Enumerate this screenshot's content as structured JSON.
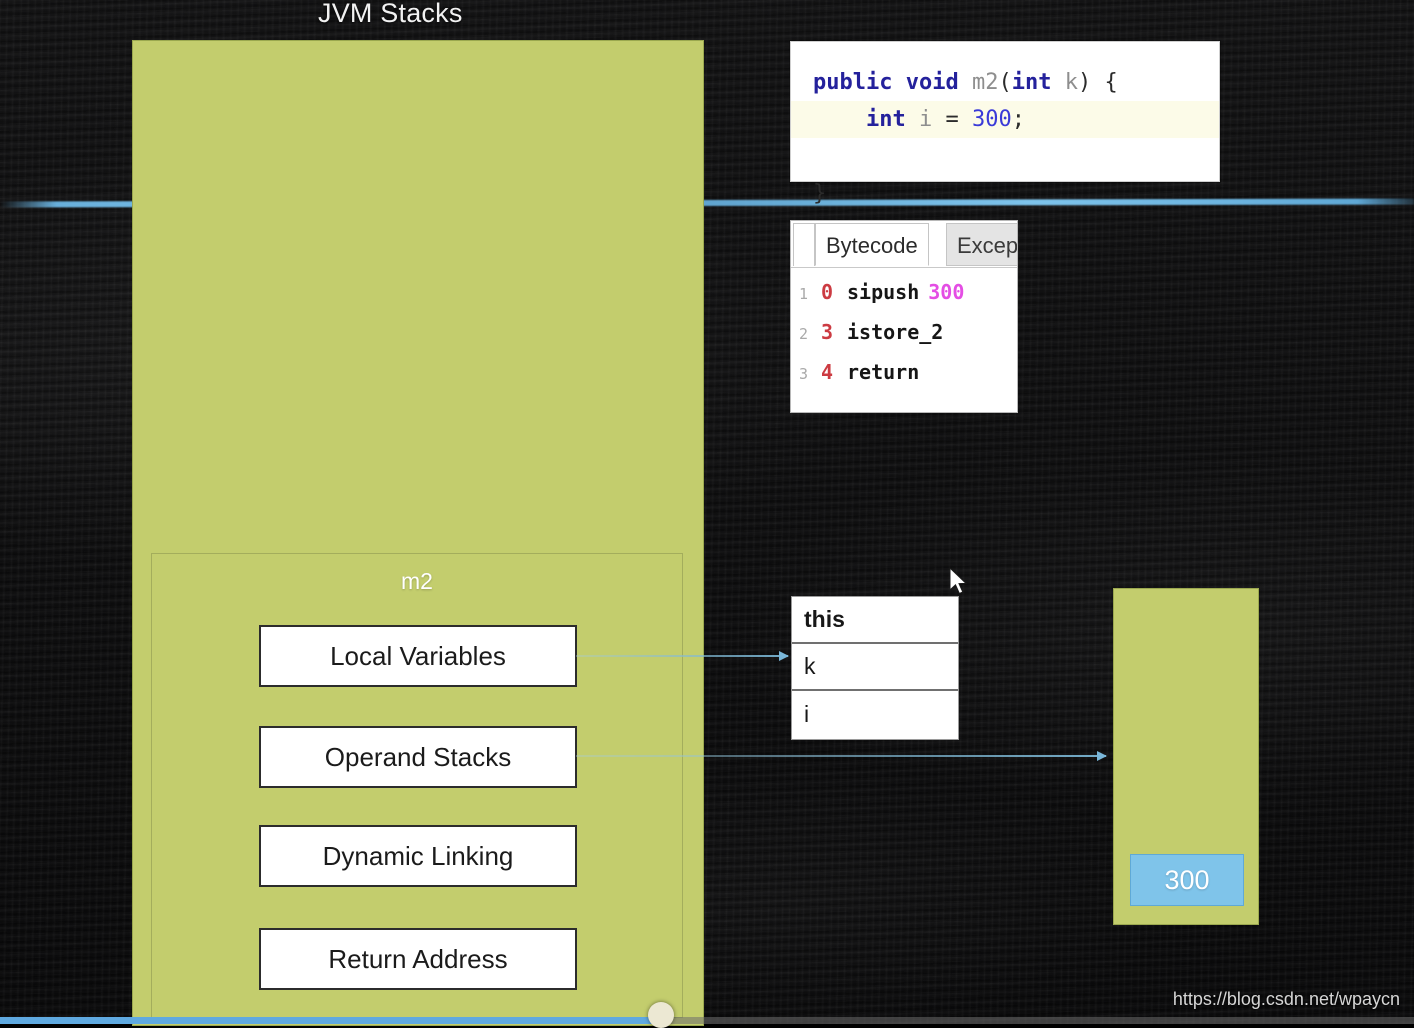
{
  "title": "JVM Stacks",
  "source_card": {
    "line1": {
      "kw1": "public",
      "kw2": "void",
      "method": "m2",
      "open_paren": "(",
      "type": "int",
      "param": "k",
      "close": ") {"
    },
    "line2": {
      "indent": "    ",
      "type": "int",
      "var": "i",
      "eq": " = ",
      "value": "300",
      "semi": ";"
    },
    "line3": "}"
  },
  "bytecode_card": {
    "tabs": [
      {
        "label": "",
        "name": "tab-stub",
        "active": false
      },
      {
        "label": "Bytecode",
        "name": "tab-bytecode",
        "active": true
      },
      {
        "label": "Excep",
        "name": "tab-exceptions",
        "active": false
      }
    ],
    "rows": [
      {
        "lineno": "1",
        "offset": "0",
        "instr": "sipush",
        "operand": "300"
      },
      {
        "lineno": "2",
        "offset": "3",
        "instr": "istore_2",
        "operand": ""
      },
      {
        "lineno": "3",
        "offset": "4",
        "instr": "return",
        "operand": ""
      }
    ]
  },
  "stack_frame": {
    "label": "m2",
    "slots": [
      {
        "label": "Local Variables",
        "name": "slot-local-variables"
      },
      {
        "label": "Operand Stacks",
        "name": "slot-operand-stacks"
      },
      {
        "label": "Dynamic Linking",
        "name": "slot-dynamic-linking"
      },
      {
        "label": "Return Address",
        "name": "slot-return-address"
      }
    ]
  },
  "variable_table": {
    "rows": [
      {
        "name": "this",
        "bold": true
      },
      {
        "name": "k",
        "bold": false
      },
      {
        "name": "i",
        "bold": false
      }
    ]
  },
  "operand_stack": {
    "value": "300"
  },
  "watermark": "https://blog.csdn.net/wpaycn",
  "colors": {
    "panel_green": "#c3cd6d",
    "panel_border": "#9ba84f",
    "operand_blue": "#7fc4ea",
    "scanline_blue": "#7ec4ec",
    "bytecode_offset_red": "#cc3b42",
    "bytecode_operand_magenta": "#e44ee4",
    "keyword_blue": "#24219c",
    "board_black": "#0d0d0e"
  }
}
